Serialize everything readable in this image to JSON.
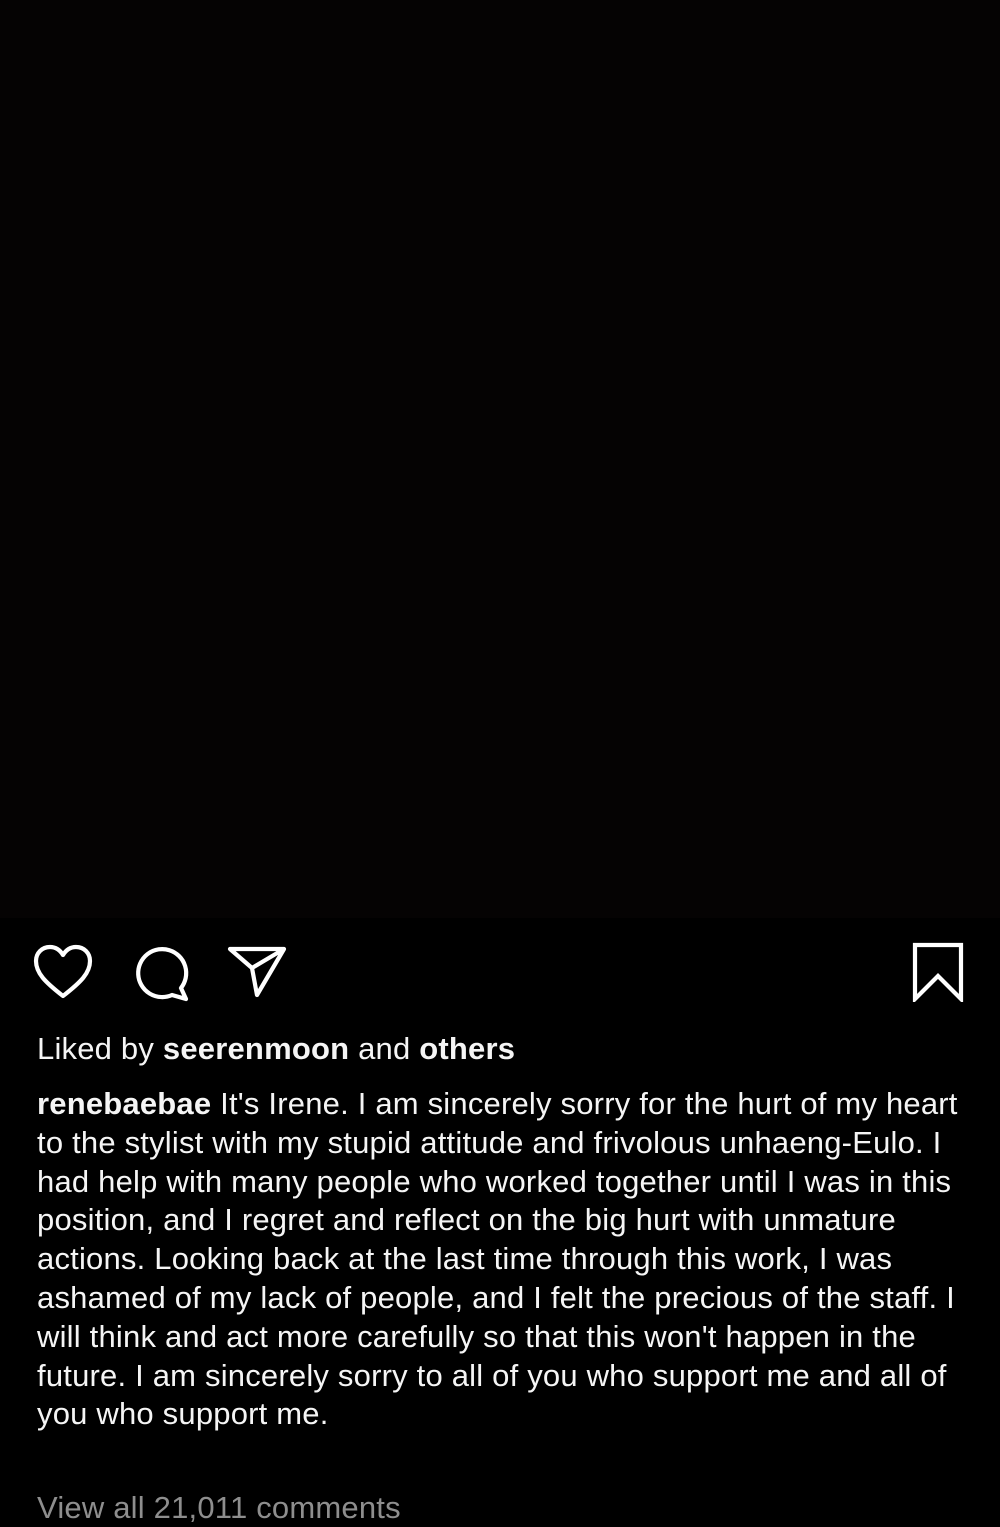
{
  "colors": {
    "background": "#000000",
    "text": "#f5f5f5",
    "muted": "#8e8e8e",
    "icon_stroke": "#ffffff"
  },
  "actions": {
    "like_icon": "heart-icon",
    "comment_icon": "comment-bubble-icon",
    "share_icon": "paper-plane-icon",
    "save_icon": "bookmark-icon"
  },
  "likes": {
    "prefix": "Liked by",
    "user": "seerenmoon",
    "connector": "and",
    "others": "others"
  },
  "caption": {
    "username": "renebaebae",
    "text": "It's Irene. I am sincerely sorry for the hurt of my heart to the stylist with my stupid attitude and frivolous unhaeng-Eulo. I had help with many people who worked together until I was in this position, and I regret and reflect on the big hurt with unmature actions. Looking back at the last time through this work, I was ashamed of my lack of people, and I felt the precious of the staff. I will think and act more carefully so that this won't happen in the future. I am sincerely sorry to all of you who support me and all of you who support me."
  },
  "comments": {
    "view_all_label": "View all 21,011 comments"
  }
}
